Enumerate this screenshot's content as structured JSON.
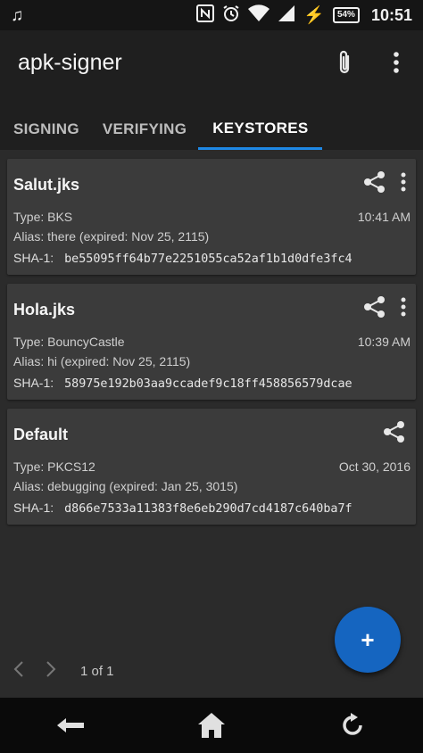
{
  "status_bar": {
    "time": "10:51",
    "battery": "54%",
    "icons": [
      "music-note-icon",
      "nfc-icon",
      "alarm-icon",
      "wifi-icon",
      "cell-signal-icon",
      "charging-icon",
      "battery-icon"
    ]
  },
  "app_bar": {
    "title": "apk-signer",
    "actions": [
      "attach-icon",
      "overflow-menu-icon"
    ]
  },
  "tabs": [
    {
      "label": "SIGNING",
      "active": false
    },
    {
      "label": "VERIFYING",
      "active": false
    },
    {
      "label": "KEYSTORES",
      "active": true
    }
  ],
  "keystores": [
    {
      "name": "Salut.jks",
      "type": "Type: BKS",
      "time": "10:41 AM",
      "alias": "Alias: there (expired: Nov 25, 2115)",
      "sha_label": "SHA-1:",
      "sha": "be55095ff64b77e2251055ca52af1b1d0dfe3fc4",
      "has_menu": true
    },
    {
      "name": "Hola.jks",
      "type": "Type: BouncyCastle",
      "time": "10:39 AM",
      "alias": "Alias: hi (expired: Nov 25, 2115)",
      "sha_label": "SHA-1:",
      "sha": "58975e192b03aa9ccadef9c18ff458856579dcae",
      "has_menu": true
    },
    {
      "name": "Default",
      "type": "Type: PKCS12",
      "time": "Oct 30, 2016",
      "alias": "Alias: debugging (expired: Jan 25, 3015)",
      "sha_label": "SHA-1:",
      "sha": "d866e7533a11383f8e6eb290d7cd4187c640ba7f",
      "has_menu": false
    }
  ],
  "pager": {
    "text": "1 of 1"
  },
  "fab": {
    "label": "+"
  },
  "colors": {
    "accent": "#1e88e5",
    "fab": "#1565c0",
    "card": "#3b3b3b",
    "app_bar": "#1f1f1f",
    "background": "#2b2b2b"
  }
}
